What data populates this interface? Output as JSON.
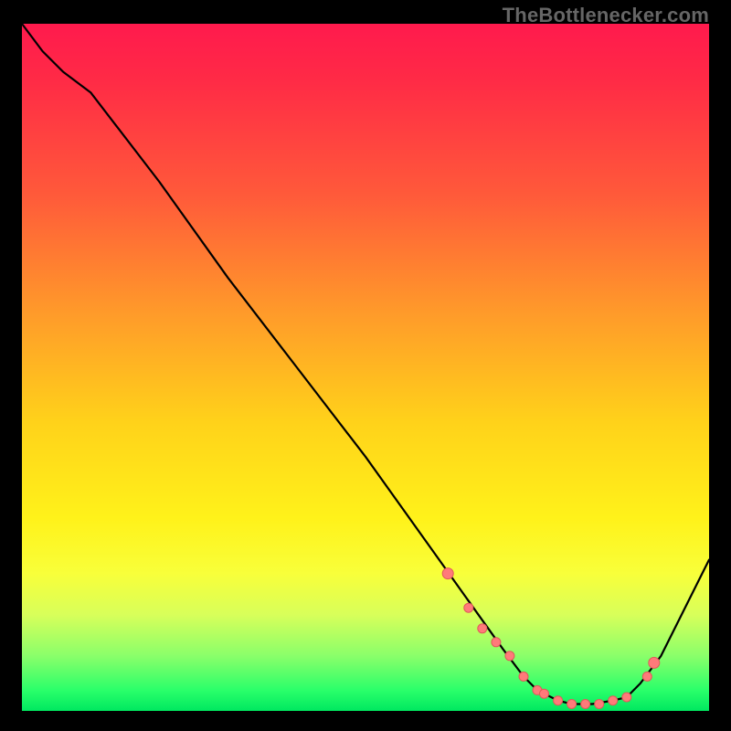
{
  "attribution": "TheBottlenecker.com",
  "colors": {
    "gradient_top": "#ff1a4d",
    "gradient_mid1": "#ff9a2a",
    "gradient_mid2": "#fff21a",
    "gradient_bottom": "#00e860",
    "curve": "#000000",
    "dot_fill": "#ff7a7a",
    "dot_stroke": "#e05a5a",
    "background": "#000000"
  },
  "chart_data": {
    "type": "line",
    "title": "",
    "xlabel": "",
    "ylabel": "",
    "xlim": [
      0,
      100
    ],
    "ylim": [
      0,
      100
    ],
    "grid": false,
    "legend": false,
    "series": [
      {
        "name": "curve",
        "x": [
          0,
          3,
          6,
          10,
          20,
          30,
          40,
          50,
          60,
          65,
          70,
          73,
          75,
          78,
          80,
          83,
          86,
          88,
          90,
          93,
          97,
          100
        ],
        "values": [
          100,
          96,
          93,
          90,
          77,
          63,
          50,
          37,
          23,
          16,
          9,
          5,
          3,
          1.5,
          1,
          1,
          1.5,
          2,
          4,
          8,
          16,
          22
        ]
      }
    ],
    "highlight_points": {
      "name": "dots",
      "x": [
        62,
        65,
        67,
        69,
        71,
        73,
        75,
        76,
        78,
        80,
        82,
        84,
        86,
        88,
        91,
        92
      ],
      "values": [
        20,
        15,
        12,
        10,
        8,
        5,
        3,
        2.5,
        1.5,
        1,
        1,
        1,
        1.5,
        2,
        5,
        7
      ]
    }
  }
}
